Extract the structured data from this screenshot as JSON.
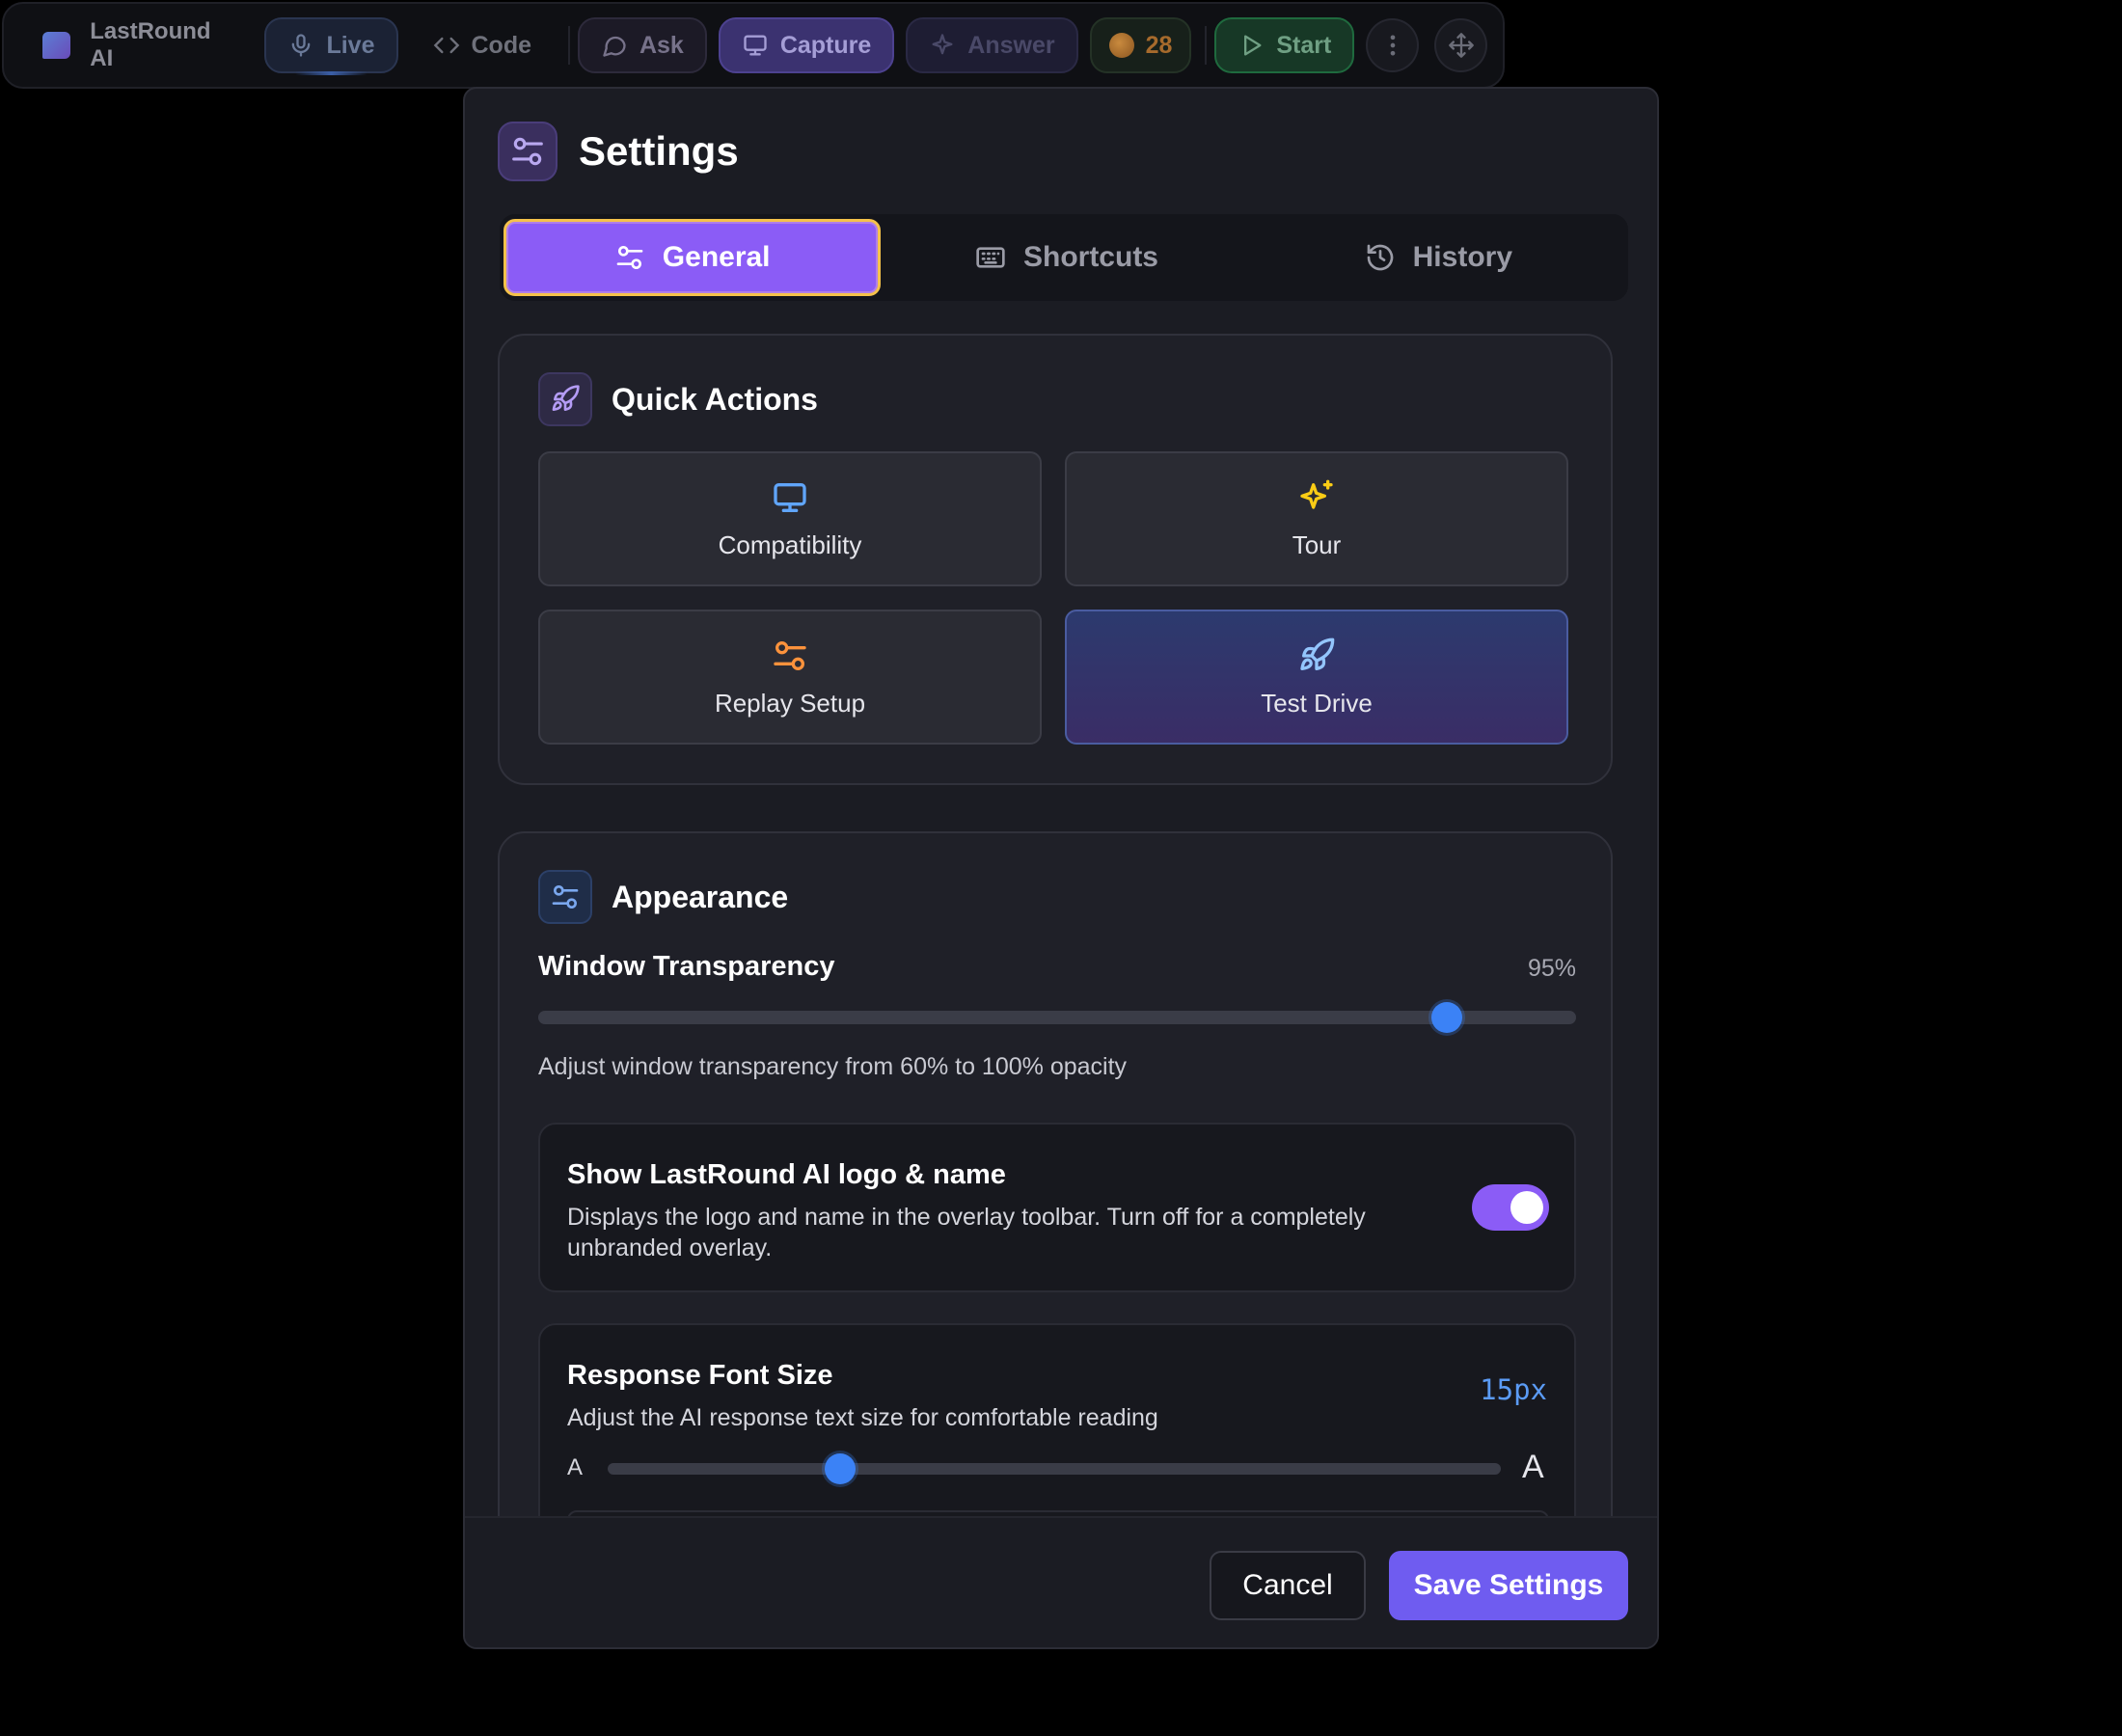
{
  "toolbar": {
    "app_name": "LastRound AI",
    "live_label": "Live",
    "code_label": "Code",
    "ask_label": "Ask",
    "capture_label": "Capture",
    "answer_label": "Answer",
    "coins": "28",
    "start_label": "Start"
  },
  "settings": {
    "title": "Settings",
    "tabs": [
      {
        "label": "General",
        "icon": "sliders-icon",
        "active": true
      },
      {
        "label": "Shortcuts",
        "icon": "keyboard-icon",
        "active": false
      },
      {
        "label": "History",
        "icon": "history-icon",
        "active": false
      }
    ],
    "quick_actions": {
      "title": "Quick Actions",
      "items": [
        {
          "label": "Compatibility",
          "icon": "monitor-icon",
          "color": "#60a5fa"
        },
        {
          "label": "Tour",
          "icon": "sparkles-icon",
          "color": "#facc15"
        },
        {
          "label": "Replay Setup",
          "icon": "sliders-icon",
          "color": "#fb923c"
        },
        {
          "label": "Test Drive",
          "icon": "rocket-icon",
          "color": "#93c5fd"
        }
      ]
    },
    "appearance": {
      "title": "Appearance",
      "transparency": {
        "label": "Window Transparency",
        "value": "95%",
        "level": 0.875,
        "help": "Adjust window transparency from 60% to 100% opacity"
      },
      "branding": {
        "title": "Show LastRound AI logo & name",
        "desc": "Displays the logo and name in the overlay toolbar. Turn off for a completely unbranded overlay.",
        "enabled": true
      },
      "font_size": {
        "title": "Response Font Size",
        "desc": "Adjust the AI response text size for comfortable reading",
        "value": "15px",
        "small_label": "A",
        "large_label": "A",
        "level": 0.26
      }
    },
    "footer": {
      "cancel_label": "Cancel",
      "save_label": "Save Settings"
    }
  },
  "colors": {
    "accent": "#8b5cf6",
    "save": "#6f5cf0",
    "slider": "#3b82f6"
  }
}
